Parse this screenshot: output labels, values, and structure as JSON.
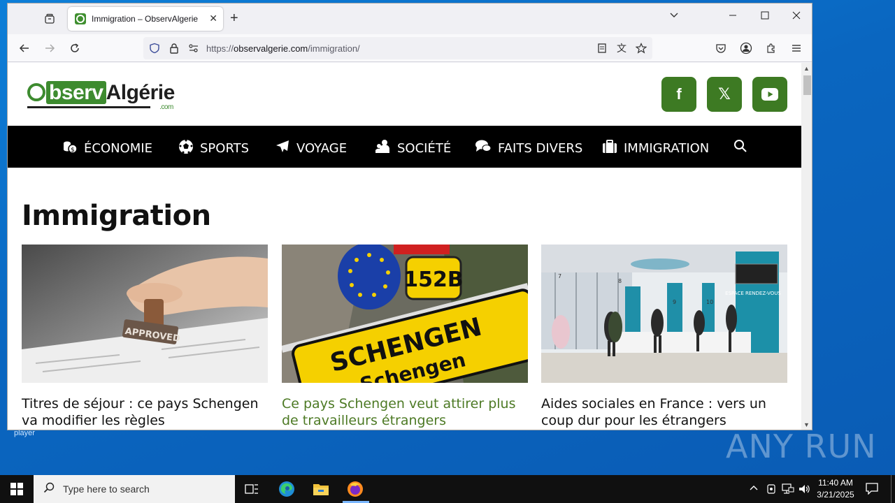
{
  "desktop": {
    "label": "player",
    "watermark": "ANY RUN"
  },
  "browser": {
    "tab": {
      "title": "Immigration – ObservAlgerie"
    },
    "url": {
      "scheme": "https://",
      "host": "observalgerie.com",
      "path": "/immigration/"
    }
  },
  "site": {
    "logo_prefix": "",
    "logo_observ": "bserv",
    "logo_rest": "Algérie",
    "logo_com": ".com",
    "social": [
      {
        "name": "facebook",
        "glyph": "f"
      },
      {
        "name": "x",
        "glyph": "𝕏"
      },
      {
        "name": "youtube",
        "glyph": "▶"
      }
    ],
    "nav": [
      {
        "label": "ÉCONOMIE",
        "icon": "coins-icon"
      },
      {
        "label": "SPORTS",
        "icon": "soccer-ball-icon"
      },
      {
        "label": "VOYAGE",
        "icon": "plane-icon"
      },
      {
        "label": "SOCIÉTÉ",
        "icon": "people-icon"
      },
      {
        "label": "FAITS DIVERS",
        "icon": "comments-icon"
      },
      {
        "label": "IMMIGRATION",
        "icon": "suitcase-icon"
      }
    ],
    "page_title": "Immigration",
    "articles": [
      {
        "title": "Titres de séjour : ce pays Schengen va modifier les règles"
      },
      {
        "title": "Ce pays Schengen veut attirer plus de travailleurs étrangers"
      },
      {
        "title": "Aides sociales en France : vers un coup dur pour les étrangers"
      }
    ]
  },
  "sign": {
    "plate": "152B",
    "line1": "SCHENGEN",
    "line2": "Schengen"
  },
  "stamp": {
    "text": "APPROVED"
  },
  "office": {
    "sign": "ESPACE RENDEZ-VOUS",
    "numbers": [
      "7",
      "8",
      "9",
      "10"
    ]
  },
  "taskbar": {
    "search_placeholder": "Type here to search",
    "time": "11:40 AM",
    "date": "3/21/2025"
  },
  "colors": {
    "brand_green": "#3d7a23",
    "nav_bg": "#000000",
    "link_green": "#4d7a25"
  }
}
